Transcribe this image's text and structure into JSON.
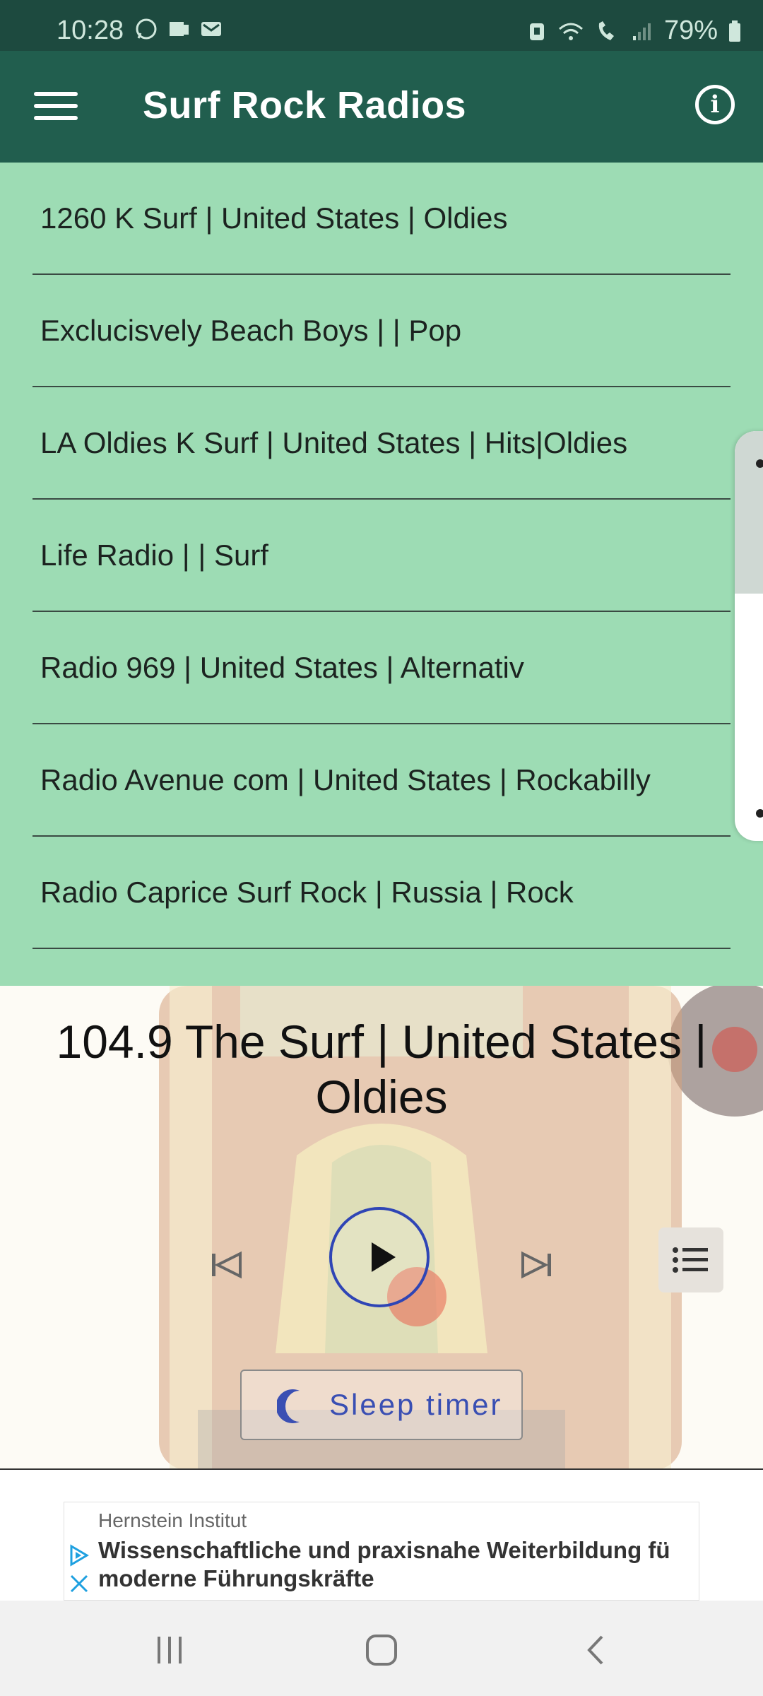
{
  "status_bar": {
    "time": "10:28",
    "battery": "79%"
  },
  "app_bar": {
    "title": "Surf Rock Radios",
    "menu_icon": "hamburger-menu-icon",
    "info_icon": "info-icon"
  },
  "stations": [
    "1260 K Surf | United States | Oldies",
    "Exclucisvely Beach Boys | | Pop",
    "LA Oldies K Surf | United States | Hits|Oldies",
    "Life Radio | | Surf",
    "Radio 969 | United States | Alternativ",
    "Radio Avenue com | United States | Rockabilly",
    "Radio Caprice Surf Rock | Russia | Rock"
  ],
  "player": {
    "now_playing": "104.9 The Surf | United States | Oldies",
    "sleep_timer_label": "Sleep timer",
    "accent_color": "#2f45b5"
  },
  "ad": {
    "advertiser": "Hernstein Institut",
    "headline": "Wissenschaftliche und praxisnahe Weiterbildung fü moderne Führungskräfte"
  },
  "colors": {
    "status_bar": "#1d4a3f",
    "app_bar": "#215e4e",
    "list_background": "#9ddcb4"
  }
}
